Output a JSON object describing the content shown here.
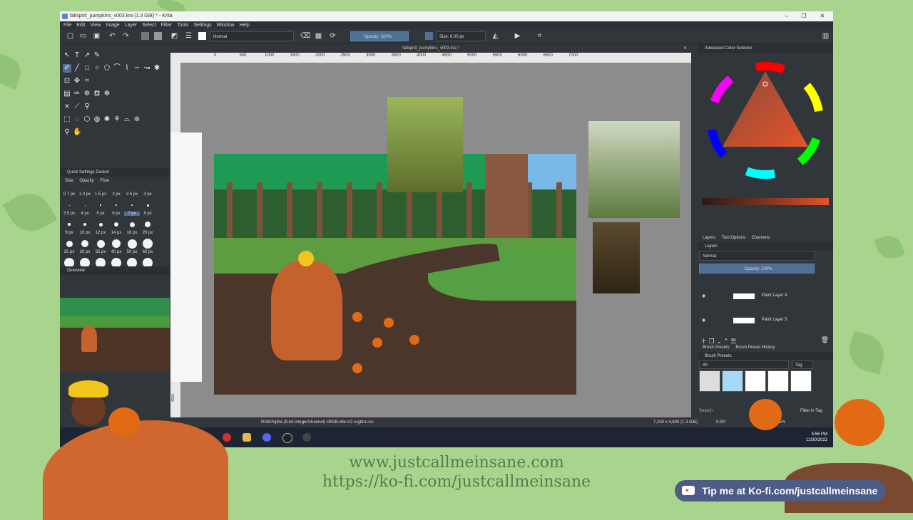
{
  "window": {
    "title": "fallspirit_pumpkins_v003.kra (1.3 GiB)  * - Krita",
    "doc_tab": "fallspirit_pumpkins_v003.kra *"
  },
  "menu": [
    "File",
    "Edit",
    "View",
    "Image",
    "Layer",
    "Select",
    "Filter",
    "Tools",
    "Settings",
    "Window",
    "Help"
  ],
  "toolbar": {
    "blend_mode": "Normal",
    "opacity": "Opacity: 100%",
    "size": "Size: 6.00 px"
  },
  "ruler": [
    "0",
    "500",
    "1000",
    "1500",
    "2000",
    "2500",
    "3000",
    "3500",
    "4000",
    "4500",
    "5000",
    "5500",
    "6000",
    "6500",
    "7000"
  ],
  "vruler": [
    "0",
    "500",
    "1000",
    "1500",
    "2000",
    "2500",
    "3000",
    "3500",
    "4000",
    "4500"
  ],
  "quick_settings": {
    "title": "Quick Settings Docker",
    "tabs": [
      "Size",
      "Opacity",
      "Flow"
    ],
    "sizes": [
      "0.7 px",
      "1.0 px",
      "1.5 px",
      "2 px",
      "2.5 px",
      "3 px",
      "3.5 px",
      "4 px",
      "5 px",
      "6 px",
      "7 px",
      "8 px",
      "9 px",
      "10 px",
      "12 px",
      "14 px",
      "16 px",
      "20 px",
      "25 px",
      "30 px",
      "35 px",
      "40 px",
      "50 px",
      "60 px"
    ],
    "selected": "7 px"
  },
  "overview": {
    "title": "Overview"
  },
  "color_selector": {
    "title": "Advanced Color Selector"
  },
  "panel_tabs": [
    "Layers",
    "Tool Options",
    "Channels"
  ],
  "layers": {
    "title": "Layers",
    "blend_mode": "Normal",
    "opacity": "Opacity:  100%",
    "items": [
      {
        "name": "Paint Layer 4"
      },
      {
        "name": "Paint Layer 5"
      }
    ]
  },
  "brush_tabs": [
    "Brush Presets",
    "Brush Preset History"
  ],
  "brush_presets": {
    "title": "Brush Presets",
    "filter": "All",
    "tag": "Tag",
    "search": "Search",
    "filter_in_tag": "Filter in Tag"
  },
  "status": {
    "colorspace": "RGB/Alpha (8-bit integer/channel)  sRGB-elle-V2-srgbtrc.icc",
    "dimensions": "7,200 x 4,800 (1.3 GiB)",
    "rotation": "0.00°",
    "zoom": "12.5%"
  },
  "taskbar": {
    "time": "5:56 PM",
    "date": "12/30/2022"
  },
  "overlay": {
    "url1": "www.justcallmeinsane.com",
    "url2": "https://ko-fi.com/justcallmeinsane",
    "kofi": "Tip me at Ko-fi.com/justcallmeinsane"
  },
  "colors": {
    "accent": "#4f6f95",
    "background": "#a9d48e",
    "panel": "#31363b"
  }
}
